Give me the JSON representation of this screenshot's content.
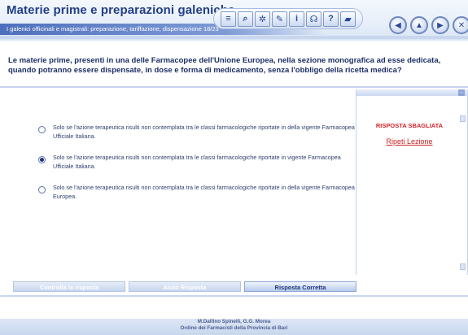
{
  "header": {
    "title": "Materie prime e preparazioni galeniche",
    "subtitle": "I galenici officinali e magistrali: preparazione, tariffazione, dispensazione 18/23",
    "toolbar_icons": [
      "list-icon",
      "search-icon",
      "network-icon",
      "edit-icon",
      "info-icon",
      "headset-icon",
      "help-icon",
      "eraser-icon"
    ],
    "toolbar_glyphs": [
      "≡",
      "⌕",
      "✲",
      "✎",
      "i",
      "☊",
      "?",
      "▰"
    ],
    "nav_glyphs": [
      "◀",
      "▲",
      "▶",
      "✕"
    ]
  },
  "question": "Le materie prime, presenti in una delle Farmacopee dell'Unione Europea, nella sezione monografica ad esse dedicata, quando potranno essere dispensate, in dose e forma di medicamento, senza l'obbligo della ricetta medica?",
  "answers": [
    {
      "text": "Solo se l'azione terapeutica risulti non contemplata tra le classi farmacologiche riportate in della vigente Farmacopea Ufficiale Italiana.",
      "selected": false
    },
    {
      "text": "Solo se l'azione terapeutica risulti non contemplata tra le classi farmacologiche riportate in vigente Farmacopea Ufficiale Italiana.",
      "selected": true
    },
    {
      "text": "Solo se l'azione terapeutica risulti non contemplata tra le classi farmacologiche riportate in della vigente Farmacopea Europea.",
      "selected": false
    }
  ],
  "feedback": {
    "verdict": "RISPOSTA SBAGLIATA",
    "retry_link": "Ripeti Lezione",
    "verdict_color": "#d2272a"
  },
  "buttons": {
    "check": "Controlla la risposta",
    "help": "Aiuto Risposta",
    "correct": "Risposta Corretta"
  },
  "footer": {
    "line1": "M.Dalfino Spinelli, G.G. Morea",
    "line2": "Ordine dei Farmacisti della Provincia di Bari"
  }
}
